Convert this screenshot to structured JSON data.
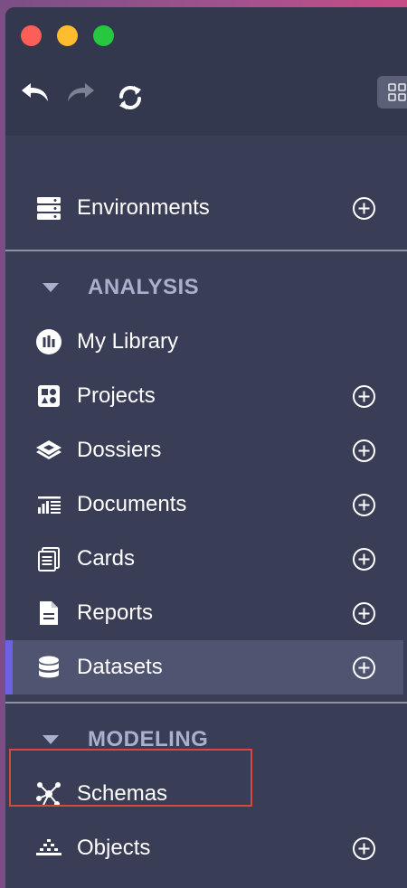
{
  "toolbar": {
    "undo_icon": "undo-icon",
    "redo_icon": "redo-icon",
    "refresh_icon": "refresh-icon",
    "grid_icon": "grid-view-icon"
  },
  "navigation": {
    "environments": {
      "label": "Environments",
      "icon": "server-icon",
      "has_add": true
    },
    "analysis": {
      "title": "ANALYSIS",
      "items": [
        {
          "label": "My Library",
          "icon": "library-icon",
          "has_add": false
        },
        {
          "label": "Projects",
          "icon": "projects-icon",
          "has_add": true
        },
        {
          "label": "Dossiers",
          "icon": "dossier-icon",
          "has_add": true
        },
        {
          "label": "Documents",
          "icon": "document-icon",
          "has_add": true
        },
        {
          "label": "Cards",
          "icon": "cards-icon",
          "has_add": true
        },
        {
          "label": "Reports",
          "icon": "report-icon",
          "has_add": true
        },
        {
          "label": "Datasets",
          "icon": "database-icon",
          "has_add": true,
          "selected": true
        }
      ]
    },
    "modeling": {
      "title": "MODELING",
      "items": [
        {
          "label": "Schemas",
          "icon": "schema-icon",
          "has_add": false,
          "highlighted": true
        },
        {
          "label": "Objects",
          "icon": "objects-icon",
          "has_add": true
        }
      ]
    }
  },
  "colors": {
    "sidebar_bg": "#393d55",
    "titlebar_bg": "#34384f",
    "selected_bg": "#4f5470",
    "selected_accent": "#6b61e3",
    "section_text": "#a9b0cd",
    "highlight_border": "#d9473d"
  }
}
